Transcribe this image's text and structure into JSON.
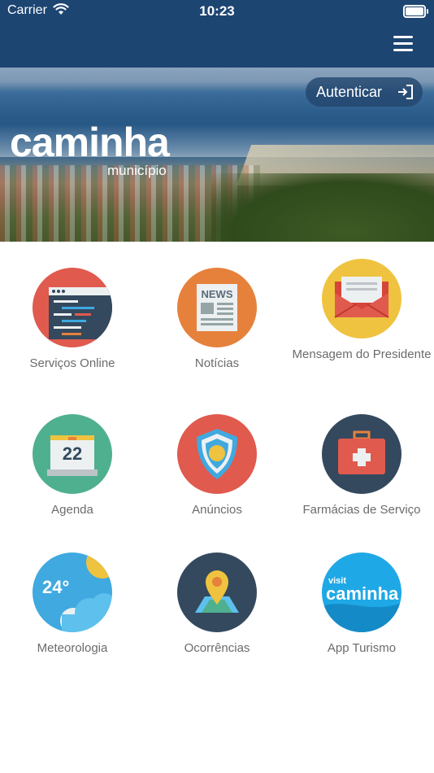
{
  "status_bar": {
    "carrier": "Carrier",
    "time": "10:23"
  },
  "header": {
    "menu_icon": "hamburger-menu-icon"
  },
  "hero": {
    "auth_label": "Autenticar",
    "auth_icon": "sign-in-icon",
    "logo_main": "caminha",
    "logo_sub": "município"
  },
  "tiles": [
    {
      "label": "Serviços Online",
      "icon": "online-services-icon",
      "color": "#e05a4e"
    },
    {
      "label": "Notícias",
      "icon": "news-icon",
      "color": "#e6813c"
    },
    {
      "label": "Mensagem do Presidente",
      "icon": "envelope-icon",
      "color": "#efc33f"
    },
    {
      "label": "Agenda",
      "icon": "calendar-icon",
      "day": "22",
      "color": "#4fb08f"
    },
    {
      "label": "Anúncios",
      "icon": "shield-icon",
      "color": "#e05a4e"
    },
    {
      "label": "Farmácias de Serviço",
      "icon": "first-aid-kit-icon",
      "color": "#34495e"
    },
    {
      "label": "Meteorologia",
      "icon": "weather-icon",
      "temperature": "24°",
      "color": "#3fa9e0"
    },
    {
      "label": "Ocorrências",
      "icon": "map-pin-icon",
      "color": "#34495e"
    },
    {
      "label": "App Turismo",
      "icon": "visit-caminha-icon",
      "brand_top": "visit",
      "brand_main": "caminha",
      "color": "#1fa8e6"
    }
  ]
}
